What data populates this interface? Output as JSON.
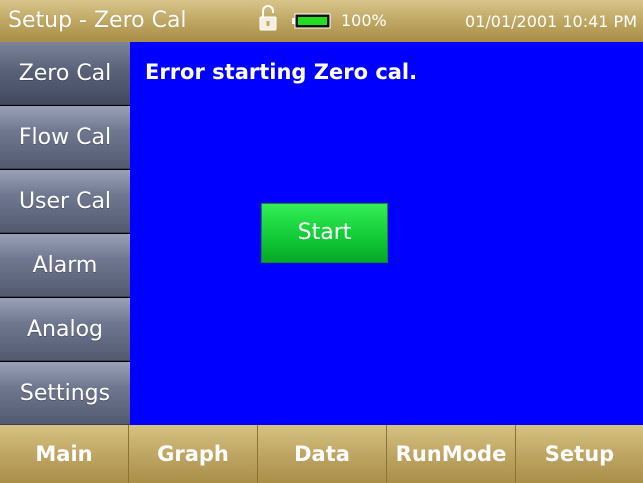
{
  "header": {
    "title": "Setup - Zero Cal",
    "lock_icon": "unlocked-padlock-icon",
    "battery_icon": "battery-icon",
    "battery_level": 100,
    "battery_text": "100%",
    "datetime": "01/01/2001 10:41 PM",
    "color": "#c2aa66"
  },
  "sidebar": {
    "items": [
      {
        "label": "Zero Cal",
        "active": true
      },
      {
        "label": "Flow Cal"
      },
      {
        "label": "User Cal"
      },
      {
        "label": "Alarm"
      },
      {
        "label": "Analog"
      },
      {
        "label": "Settings"
      }
    ],
    "color": "#6f7890"
  },
  "main": {
    "background": "#0000ff",
    "message": "Error starting Zero cal.",
    "start_label": "Start",
    "start_color": "#12cc38"
  },
  "footer": {
    "items": [
      {
        "label": "Main"
      },
      {
        "label": "Graph"
      },
      {
        "label": "Data"
      },
      {
        "label": "RunMode"
      },
      {
        "label": "Setup"
      }
    ]
  }
}
